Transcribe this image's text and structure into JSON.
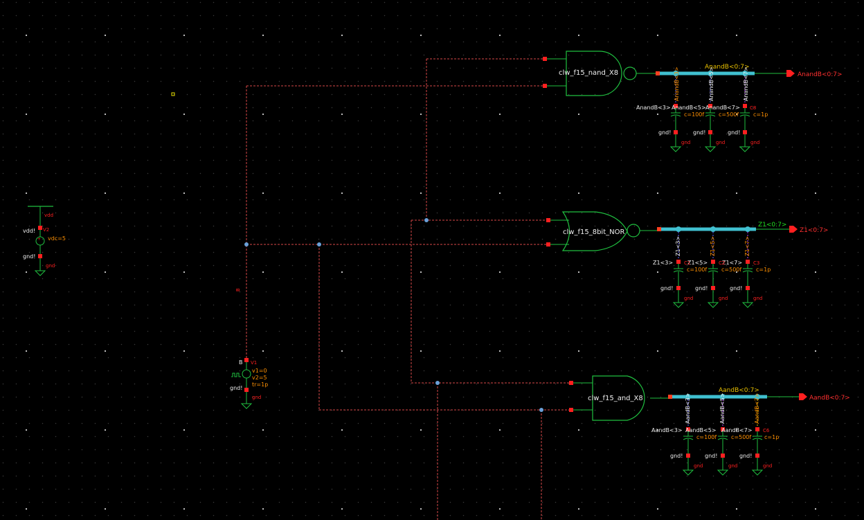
{
  "schematic": {
    "gates": [
      {
        "name": "clw_f15_nand_X8"
      },
      {
        "name": "clw_f15_8bit_NOR"
      },
      {
        "name": "clw_f15_and_X8"
      }
    ],
    "outputs": {
      "nand_bus": "AnandB<0:7>",
      "nand_pin": "AnandB<0:7>",
      "nor_bus": "Z1<0:7>",
      "nor_pin": "Z1<0:7>",
      "and_bus": "AandB<0:7>",
      "and_pin": "AandB<0:7>"
    },
    "nand_loads": {
      "taps": [
        "AnandB<3>",
        "AnandB<5>",
        "AnandB<7>"
      ],
      "nets": [
        "AnandB<3>",
        "AnandB<5>",
        "AnandB<7>"
      ],
      "caps": [
        "c=100f",
        "c=500f",
        "c=1p"
      ],
      "cap_name": "C8",
      "gnd_lbl": "gnd!",
      "gnd_sym": "gnd"
    },
    "nor_loads": {
      "taps": [
        "Z1<3>",
        "Z1<5>",
        "Z1<7>"
      ],
      "nets": [
        "Z1<3>",
        "Z1<5>",
        "Z1<7>"
      ],
      "caps": [
        "c=100f",
        "c=500f",
        "c=1p"
      ],
      "cap_names": [
        "C1",
        "C2",
        "C3"
      ],
      "gnd_lbl": "gnd!",
      "gnd_sym": "gnd"
    },
    "and_loads": {
      "taps": [
        "AandB<3>",
        "AandB<5>",
        "AandB<7>"
      ],
      "nets": [
        "AandB<3>",
        "AandB<5>",
        "AandB<7>"
      ],
      "caps": [
        "c=100f",
        "c=500f",
        "c=1p"
      ],
      "cap_name": "C6",
      "gnd_lbl": "gnd!",
      "gnd_sym": "gnd"
    },
    "vdd_source": {
      "top": "vdd",
      "net": "vdd!",
      "name": "V2",
      "param": "vdc=5",
      "gnd_lbl": "gnd!",
      "gnd_sym": "gnd"
    },
    "pulse_source": {
      "net": "B",
      "name": "V1",
      "params": [
        "v1=0",
        "v2=5",
        "tr=1p"
      ],
      "gnd_lbl": "gnd!",
      "gnd_sym": "gnd"
    },
    "wire_label": "B"
  },
  "colors": {
    "gate": "#20c040",
    "wire": "#e04040",
    "bus": "#40c0d0",
    "pin": "#ff2020",
    "dot": "#6aa0d8"
  }
}
